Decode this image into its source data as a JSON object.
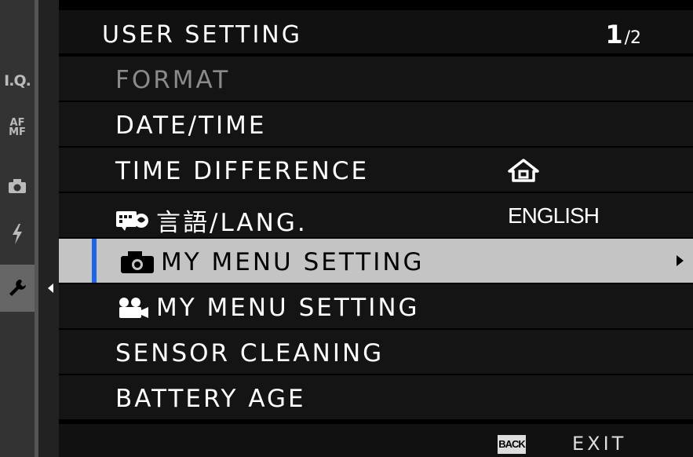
{
  "header": {
    "title": "USER SETTING",
    "page_current": "1",
    "page_total": "/2"
  },
  "sidebar": {
    "tabs": [
      {
        "name": "image-quality-tab",
        "label": "I.Q."
      },
      {
        "name": "af-mf-tab",
        "label_top": "AF",
        "label_bottom": "MF"
      },
      {
        "name": "shooting-tab",
        "icon": "camera-icon"
      },
      {
        "name": "flash-tab",
        "icon": "flash-icon"
      },
      {
        "name": "setup-tab",
        "icon": "wrench-icon",
        "active": true
      }
    ]
  },
  "menu": {
    "items": [
      {
        "label": "FORMAT",
        "value": ""
      },
      {
        "label": "DATE/TIME",
        "value": ""
      },
      {
        "label": "TIME DIFFERENCE",
        "value_icon": "home-icon"
      },
      {
        "label": "言語/LANG.",
        "label_icon": "language-icon",
        "value": "ENGLISH"
      },
      {
        "label": "MY MENU SETTING",
        "label_icon": "camera-icon",
        "selected": true
      },
      {
        "label": "MY MENU SETTING",
        "label_icon": "movie-camera-icon"
      },
      {
        "label": "SENSOR CLEANING",
        "value": ""
      },
      {
        "label": "BATTERY AGE",
        "value": ""
      }
    ]
  },
  "footer": {
    "back_key": "BACK",
    "exit_label": "EXIT"
  },
  "colors": {
    "selection_accent": "#1f63e6",
    "selected_row": "#c4c4c4",
    "row_bg": "#141414"
  }
}
